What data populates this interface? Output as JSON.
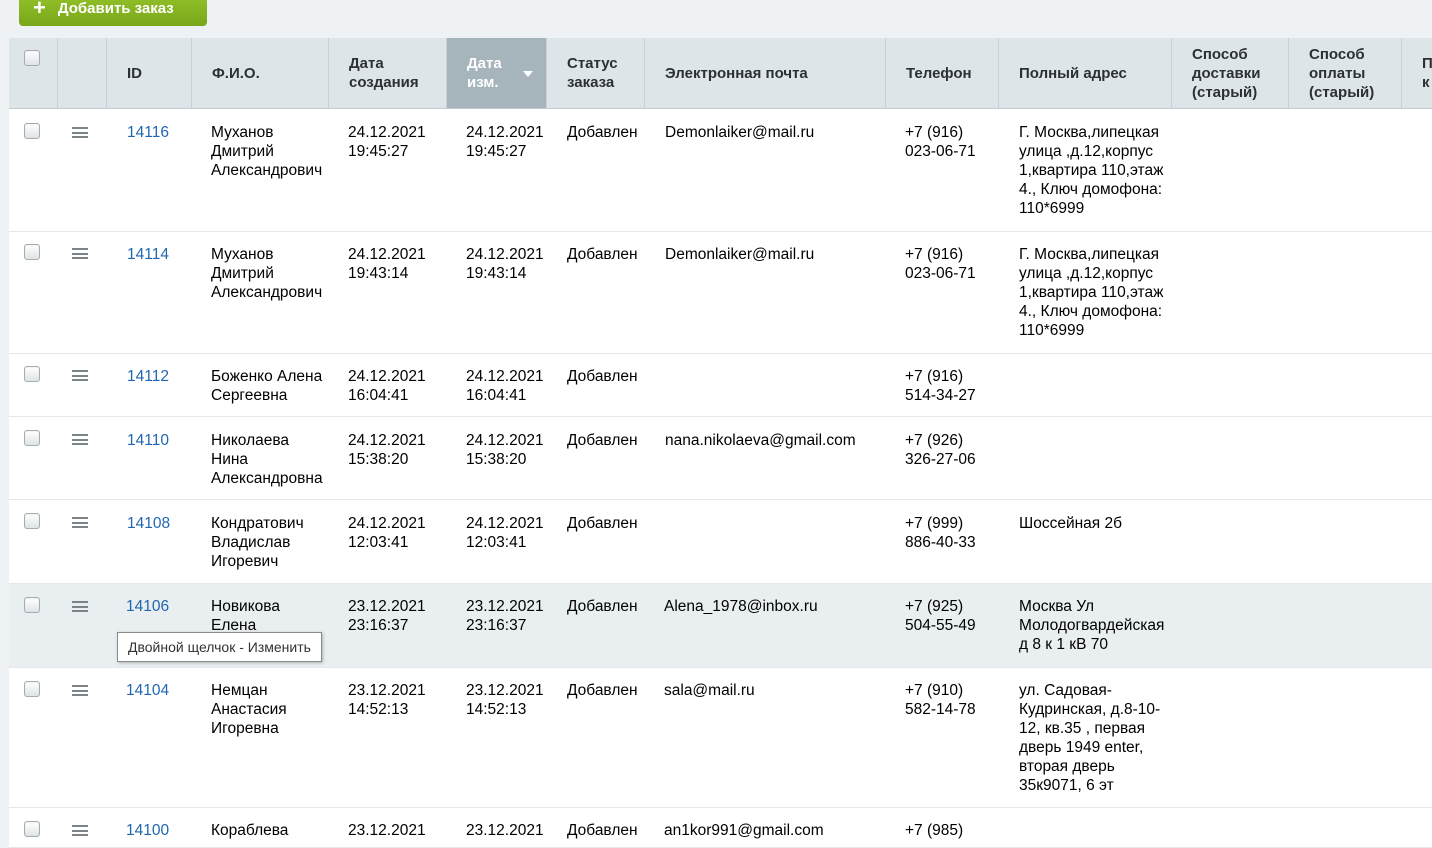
{
  "toolbar": {
    "add_order_label": "Добавить заказ",
    "add_icon": "plus-icon"
  },
  "headers": {
    "id": "ID",
    "fio": "Ф.И.О.",
    "date_created": "Дата\nсоздания",
    "date_modified": "Дата\nизм.",
    "status": "Статус\nзаказа",
    "email": "Электронная почта",
    "phone": "Телефон",
    "address": "Полный адрес",
    "delivery_old": "Способ\nдоставки\n(старый)",
    "payment_old": "Способ\nоплаты\n(старый)",
    "next_partial": "П\nк"
  },
  "rows": [
    {
      "id": "14116",
      "fio": "Муханов\nДмитрий\nАлександрович",
      "date_created": "24.12.2021\n19:45:27",
      "date_modified": "24.12.2021\n19:45:27",
      "status": "Добавлен",
      "email": "Demonlaiker@mail.ru",
      "phone": "+7 (916)\n023-06-71",
      "address": "Г. Москва,липецкая\nулица ,д.12,корпус\n1,квартира 110,этаж\n4., Ключ домофона:\n110*6999"
    },
    {
      "id": "14114",
      "fio": "Муханов\nДмитрий\nАлександрович",
      "date_created": "24.12.2021\n19:43:14",
      "date_modified": "24.12.2021\n19:43:14",
      "status": "Добавлен",
      "email": "Demonlaiker@mail.ru",
      "phone": "+7 (916)\n023-06-71",
      "address": "Г. Москва,липецкая\nулица ,д.12,корпус\n1,квартира 110,этаж\n4., Ключ домофона:\n110*6999"
    },
    {
      "id": "14112",
      "fio": "Боженко Алена\nСергеевна",
      "date_created": "24.12.2021\n16:04:41",
      "date_modified": "24.12.2021\n16:04:41",
      "status": "Добавлен",
      "email": "",
      "phone": "+7 (916)\n514-34-27",
      "address": ""
    },
    {
      "id": "14110",
      "fio": "Николаева\nНина\nАлександровна",
      "date_created": "24.12.2021\n15:38:20",
      "date_modified": "24.12.2021\n15:38:20",
      "status": "Добавлен",
      "email": "nana.nikolaeva@gmail.com",
      "phone": "+7 (926)\n326-27-06",
      "address": ""
    },
    {
      "id": "14108",
      "fio": "Кондратович\nВладислав\nИгоревич",
      "date_created": "24.12.2021\n12:03:41",
      "date_modified": "24.12.2021\n12:03:41",
      "status": "Добавлен",
      "email": "",
      "phone": "+7 (999)\n886-40-33",
      "address": "Шоссейная 2б"
    },
    {
      "id": "14106",
      "fio": "Новикова\nЕлена",
      "date_created": "23.12.2021\n23:16:37",
      "date_modified": "23.12.2021\n23:16:37",
      "status": "Добавлен",
      "email": "Alena_1978@inbox.ru",
      "phone": "+7 (925)\n504-55-49",
      "address": "Москва Ул\nМолодогвардейская\nд 8 к 1 кВ 70"
    },
    {
      "id": "14104",
      "fio": "Немцан\nАнастасия\nИгоревна",
      "date_created": "23.12.2021\n14:52:13",
      "date_modified": "23.12.2021\n14:52:13",
      "status": "Добавлен",
      "email": "sala@mail.ru",
      "phone": "+7 (910)\n582-14-78",
      "address": "ул. Садовая-\nКудринская, д.8-10-\n12, кв.35 , первая\nдверь 1949 enter,\nвторая дверь\n35к9071, 6 эт"
    },
    {
      "id": "14100",
      "fio": "Кораблева",
      "date_created": "23.12.2021",
      "date_modified": "23.12.2021",
      "status": "Добавлен",
      "email": "an1kor991@gmail.com",
      "phone": "+7 (985)",
      "address": ""
    }
  ],
  "tooltip": {
    "text": "Двойной щелчок - Изменить"
  },
  "colors": {
    "accent_green": "#7fab1e",
    "link_blue": "#2067b0",
    "header_bg": "#dde5e8",
    "sorted_header_bg": "#a6b4bb",
    "hover_row_bg": "#e9eef0"
  }
}
